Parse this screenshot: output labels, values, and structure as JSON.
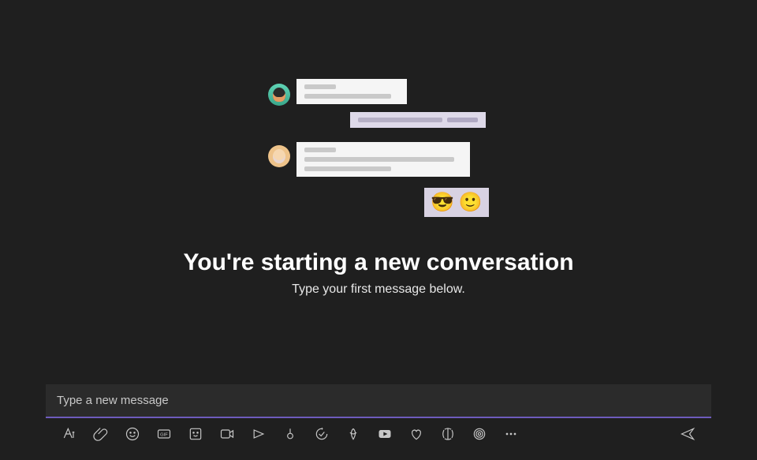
{
  "empty_state": {
    "heading": "You're starting a new conversation",
    "subheading": "Type your first message below."
  },
  "compose": {
    "placeholder": "Type a new message",
    "value": ""
  },
  "toolbar": {
    "format": "format-icon",
    "attach": "attach-icon",
    "emoji": "emoji-icon",
    "gif": "gif-icon",
    "sticker": "sticker-icon",
    "meeting": "schedule-meeting-icon",
    "stream": "stream-icon",
    "record": "record-icon",
    "approve": "approvals-icon",
    "shifts": "shifts-icon",
    "youtube": "youtube-icon",
    "like": "praise-icon",
    "app1": "app-icon",
    "app2": "app2-icon",
    "more": "more-icon",
    "send": "send-icon"
  },
  "illustration": {
    "emoji1": "😎",
    "emoji2": "🙂"
  }
}
